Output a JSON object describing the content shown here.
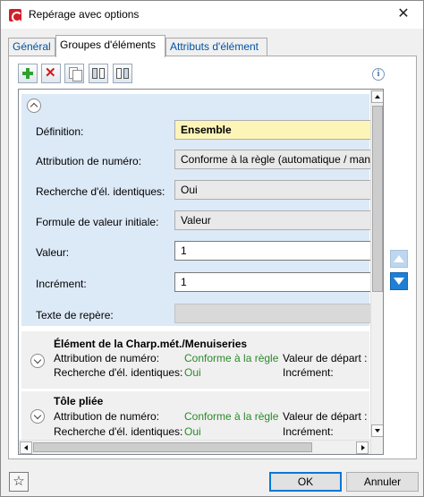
{
  "window": {
    "title": "Repérage avec options",
    "close_symbol": "✕",
    "app_icon": "hicad-logo-icon"
  },
  "tabs": [
    {
      "label": "Général",
      "active": false
    },
    {
      "label": "Groupes d'éléments",
      "active": true
    },
    {
      "label": "Attributs d'élément",
      "active": false
    }
  ],
  "toolbar": {
    "buttons": [
      "add-icon",
      "delete-icon",
      "copy-icon",
      "move-left-icon",
      "move-right-icon"
    ],
    "delete_glyph": "✕",
    "info_glyph": "i"
  },
  "expanded_group": {
    "fields": [
      {
        "label": "Définition:",
        "value": "Ensemble"
      },
      {
        "label": "Attribution de numéro:",
        "value": "Conforme à la règle (automatique / man"
      },
      {
        "label": "Recherche d'él. identiques:",
        "value": "Oui"
      },
      {
        "label": "Formule de valeur initiale:",
        "value": "Valeur"
      },
      {
        "label": "Valeur:",
        "value": "1"
      },
      {
        "label": "Incrément:",
        "value": "1"
      },
      {
        "label": "Texte de repère:",
        "value": ""
      }
    ]
  },
  "groups": [
    {
      "title": "Élément de la Charp.mét./Menuiseries",
      "numbering_label": "Attribution de numéro:",
      "numbering_value": "Conforme à la règle",
      "identical_label": "Recherche d'él. identiques:",
      "identical_value": "Oui",
      "start_label": "Valeur de départ :",
      "increment_label": "Incrément:"
    },
    {
      "title": "Tôle pliée",
      "numbering_label": "Attribution de numéro:",
      "numbering_value": "Conforme à la règle",
      "identical_label": "Recherche d'él. identiques:",
      "identical_value": "Oui",
      "start_label": "Valeur de départ :",
      "increment_label": "Incrément:"
    }
  ],
  "footer": {
    "favorite_glyph": "☆",
    "ok_label": "OK",
    "cancel_label": "Annuler"
  },
  "colors": {
    "accent": "#0078d7",
    "expanded_bg": "#dce9f7",
    "definition_bg": "#fdf5b8",
    "value_green": "#2b8a2b"
  }
}
